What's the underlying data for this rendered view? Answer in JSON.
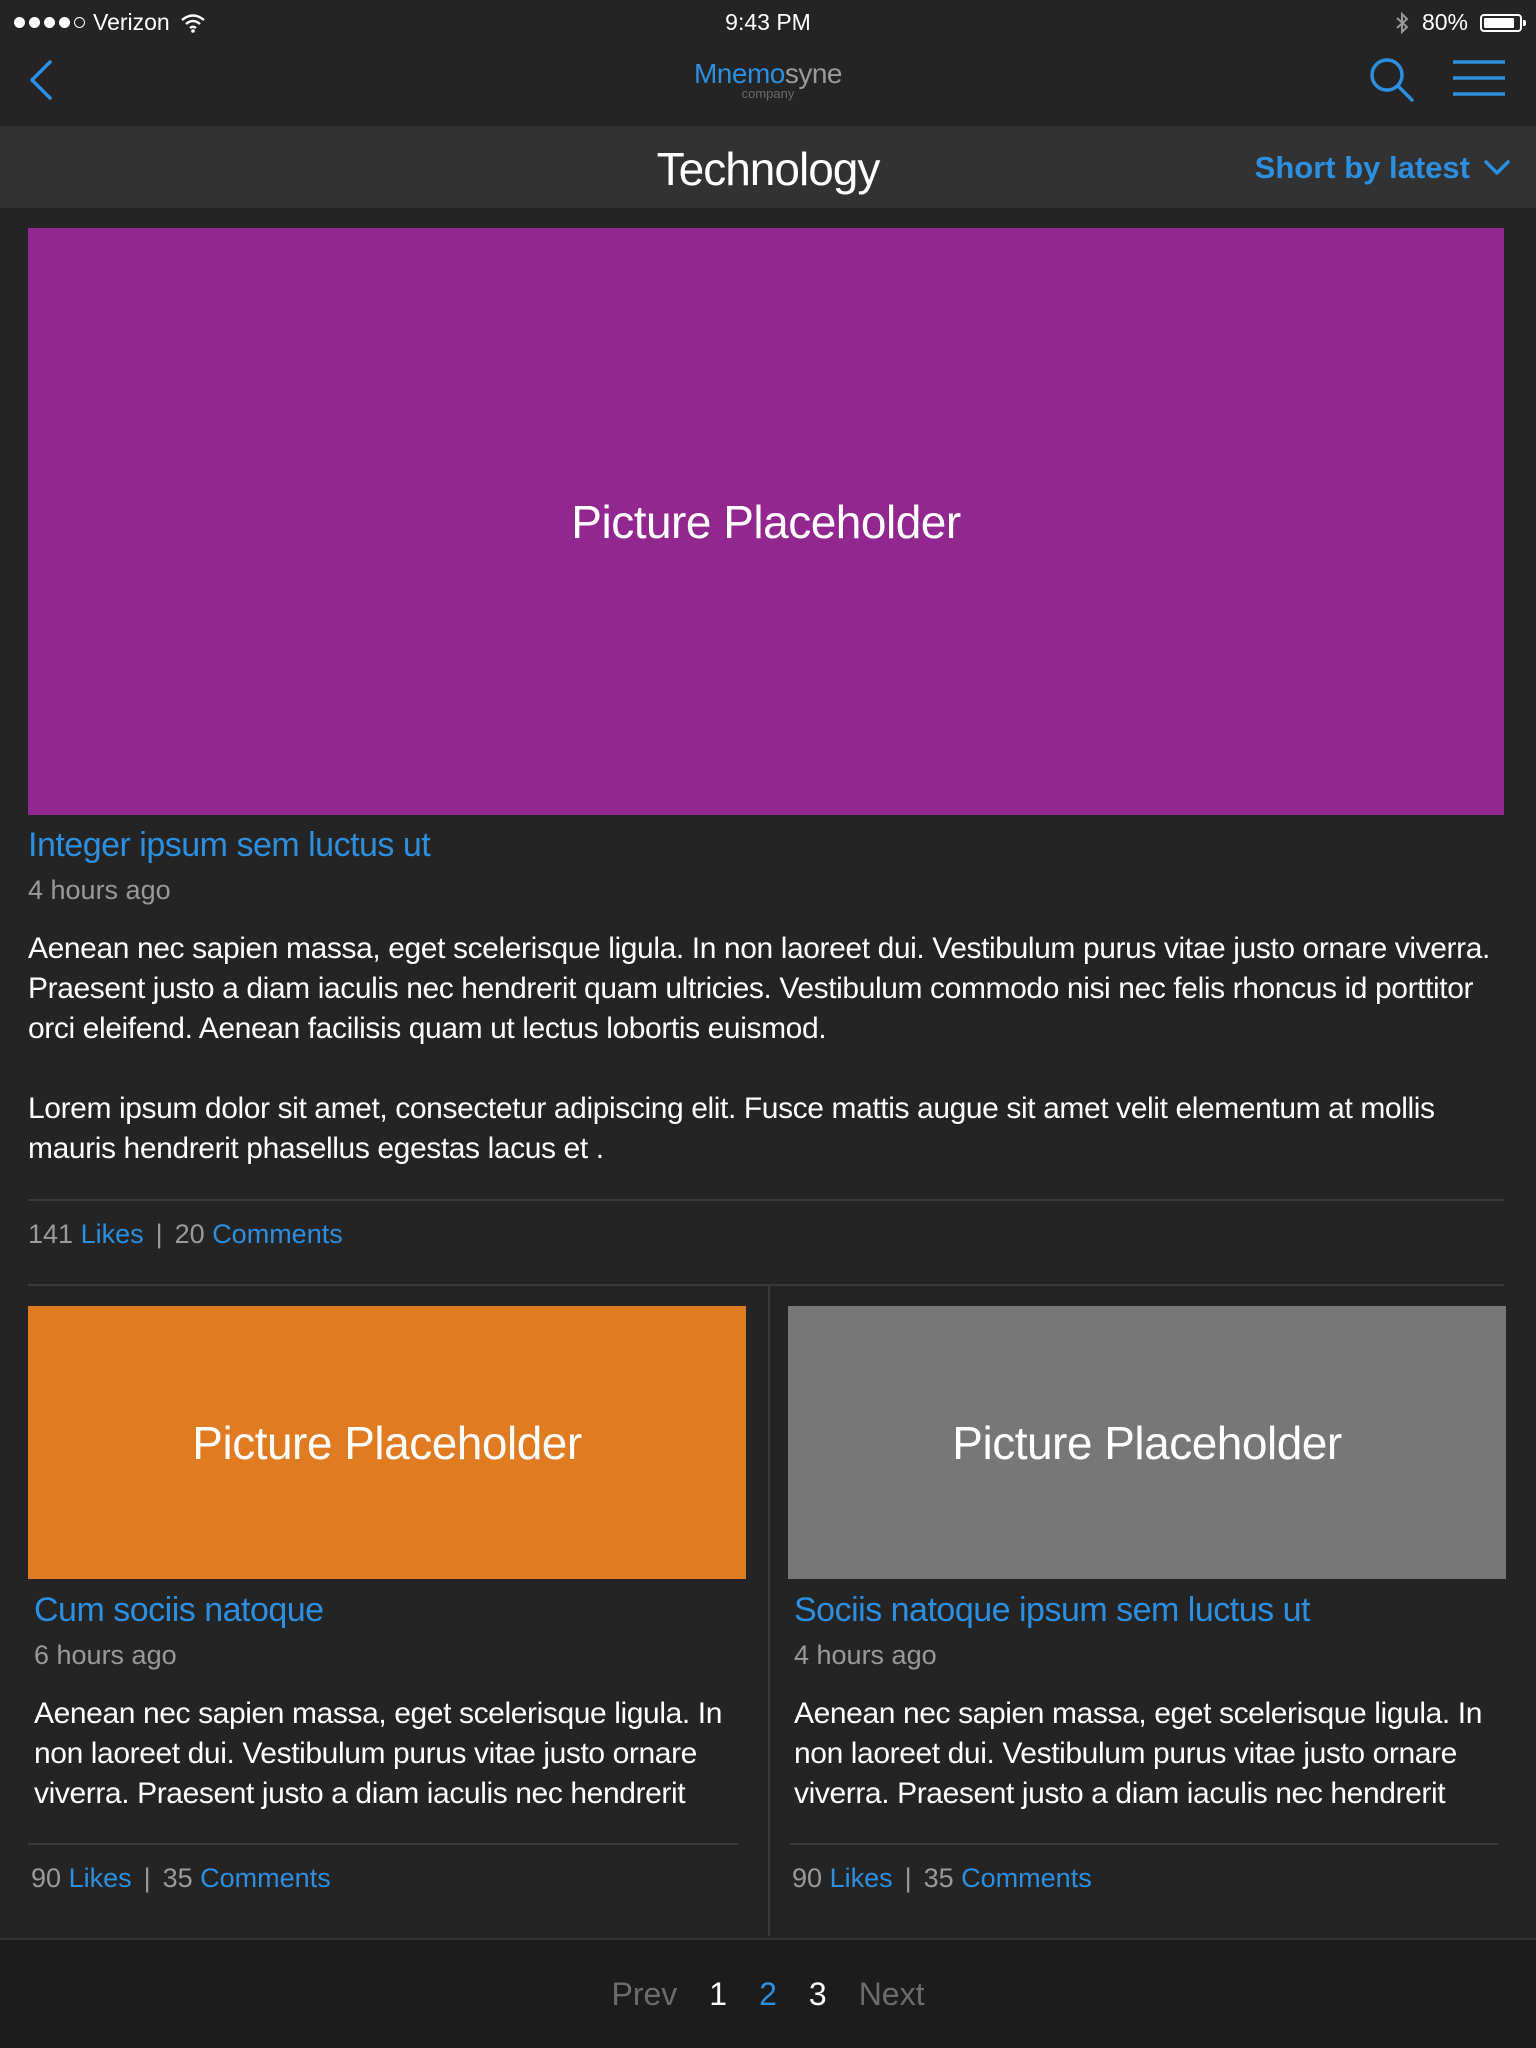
{
  "status_bar": {
    "carrier": "Verizon",
    "time": "9:43 PM",
    "battery": "80%",
    "battery_level": 0.8
  },
  "nav": {
    "logo_main_part1": "Mnemo",
    "logo_main_part2": "syne",
    "logo_sub": "company",
    "back_icon": "chevron-left-icon",
    "search_icon": "search-icon",
    "menu_icon": "hamburger-menu-icon"
  },
  "header": {
    "title": "Technology",
    "sort_label": "Short by latest"
  },
  "featured": {
    "image_label": "Picture Placeholder",
    "image_color": "#92278f",
    "title": "Integer ipsum sem luctus ut",
    "time": "4 hours ago",
    "body_1": "Aenean nec sapien massa, eget scelerisque ligula. In non laoreet dui. Vestibulum purus vitae justo ornare viverra. Praesent justo a diam iaculis nec hendrerit quam ultricies. Vestibulum commodo nisi nec felis rhoncus id porttitor orci eleifend. Aenean facilisis quam ut lectus lobortis euismod.",
    "body_2": "Lorem ipsum dolor sit amet, consectetur adipiscing elit. Fusce mattis augue sit amet velit elementum at mollis mauris hendrerit phasellus egestas lacus et .",
    "likes_count": "141",
    "likes_label": "Likes",
    "comments_count": "20",
    "comments_label": "Comments"
  },
  "cards": [
    {
      "image_label": "Picture Placeholder",
      "image_color": "#e07b22",
      "title": "Cum sociis natoque",
      "time": "6 hours ago",
      "body": "Aenean nec sapien massa, eget scelerisque ligula. In non laoreet dui. Vestibulum purus vitae justo ornare viverra. Praesent justo a diam iaculis nec hendrerit",
      "likes_count": "90",
      "likes_label": "Likes",
      "comments_count": "35",
      "comments_label": "Comments"
    },
    {
      "image_label": "Picture Placeholder",
      "image_color": "#777777",
      "title": "Sociis natoque ipsum sem luctus ut",
      "time": "4 hours ago",
      "body": "Aenean nec sapien massa, eget scelerisque ligula. In non laoreet dui. Vestibulum purus vitae justo ornare viverra. Praesent justo a diam iaculis nec hendrerit",
      "likes_count": "90",
      "likes_label": "Likes",
      "comments_count": "35",
      "comments_label": "Comments"
    }
  ],
  "pagination": {
    "prev": "Prev",
    "pages": [
      "1",
      "2",
      "3"
    ],
    "current": "2",
    "next": "Next"
  },
  "colors": {
    "accent": "#2c8fe0",
    "background": "#242424",
    "header_bar": "#323232"
  }
}
